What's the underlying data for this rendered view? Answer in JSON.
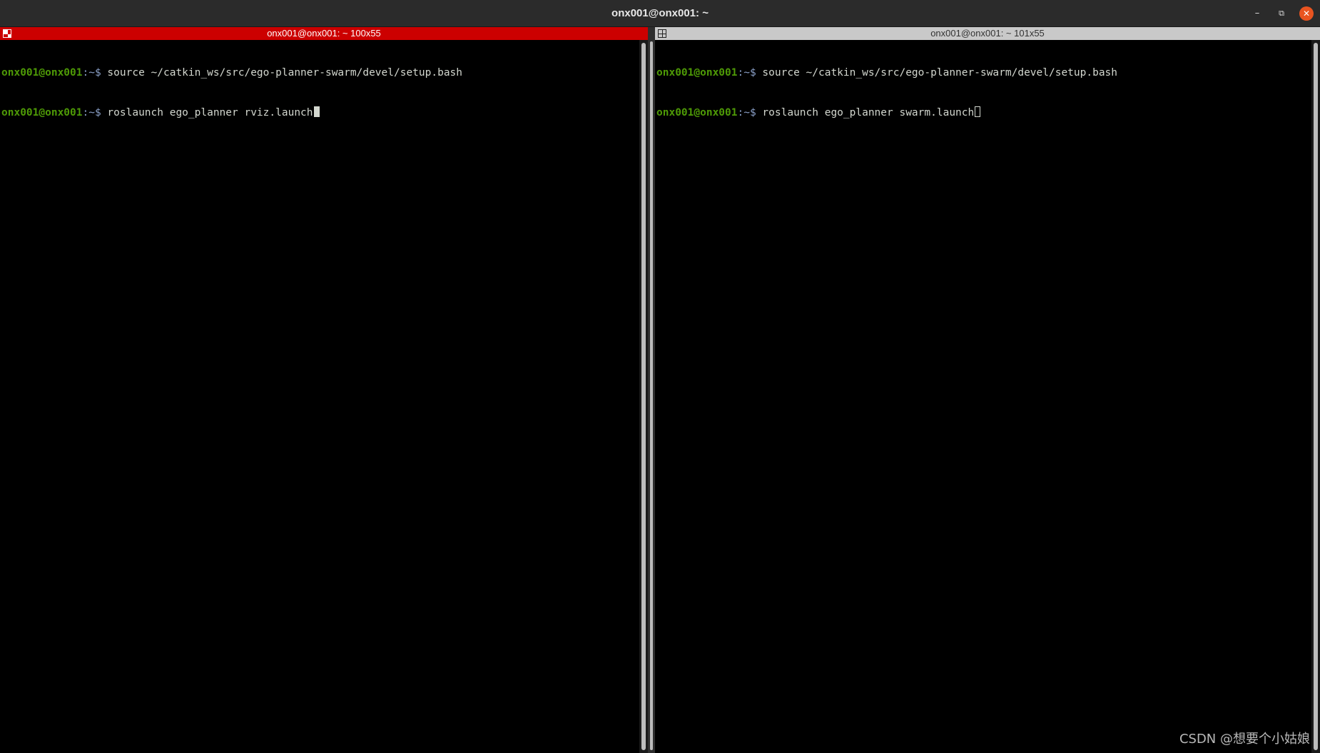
{
  "window": {
    "title": "onx001@onx001: ~",
    "minimize_glyph": "–",
    "maximize_glyph": "⧉",
    "close_glyph": "✕",
    "accent_color": "#e95420"
  },
  "left_pane": {
    "header": "onx001@onx001: ~ 100x55",
    "header_color": "#cc0000",
    "lines": [
      {
        "user": "onx001@onx001",
        "sep": ":~$ ",
        "cmd": "source ~/catkin_ws/src/ego-planner-swarm/devel/setup.bash"
      },
      {
        "user": "onx001@onx001",
        "sep": ":~$ ",
        "cmd": "roslaunch ego_planner rviz.launch"
      }
    ]
  },
  "right_pane": {
    "header": "onx001@onx001: ~ 101x55",
    "header_color": "#c9c9c9",
    "lines": [
      {
        "user": "onx001@onx001",
        "sep": ":~$ ",
        "cmd": "source ~/catkin_ws/src/ego-planner-swarm/devel/setup.bash"
      },
      {
        "user": "onx001@onx001",
        "sep": ":~$ ",
        "cmd": "roslaunch ego_planner swarm.launch"
      }
    ]
  },
  "watermark": "CSDN @想要个小姑娘"
}
